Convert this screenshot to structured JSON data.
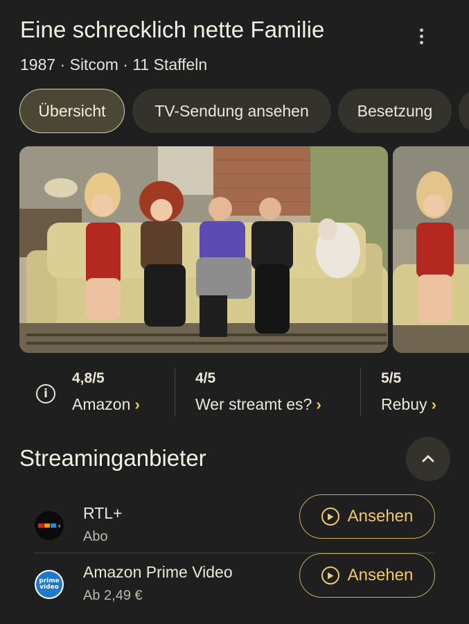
{
  "header": {
    "title": "Eine schrecklich nette Familie",
    "subtitle": "1987 · Sitcom · 11 Staffeln",
    "more_icon": "more-vert-icon"
  },
  "tabs": [
    {
      "label": "Übersicht",
      "active": true
    },
    {
      "label": "TV-Sendung ansehen",
      "active": false
    },
    {
      "label": "Besetzung",
      "active": false
    }
  ],
  "ratings": {
    "info_icon": "info-icon",
    "items": [
      {
        "score": "4,8/5",
        "source": "Amazon"
      },
      {
        "score": "4/5",
        "source": "Wer streamt es?"
      },
      {
        "score": "5/5",
        "source": "Rebuy"
      }
    ],
    "chevron": "›"
  },
  "streaming": {
    "title": "Streaminganbieter",
    "collapse_icon": "chevron-up-icon",
    "providers": [
      {
        "name": "RTL+",
        "detail": "Abo",
        "logo": "rtl-plus-logo",
        "button": "Ansehen"
      },
      {
        "name": "Amazon Prime Video",
        "detail": "Ab 2,49 €",
        "logo": "prime-video-logo",
        "logo_text": "prime video",
        "button": "Ansehen"
      }
    ]
  },
  "colors": {
    "background": "#1f1f1f",
    "accent": "#f3c969",
    "active_tab_bg": "#4a4734"
  }
}
